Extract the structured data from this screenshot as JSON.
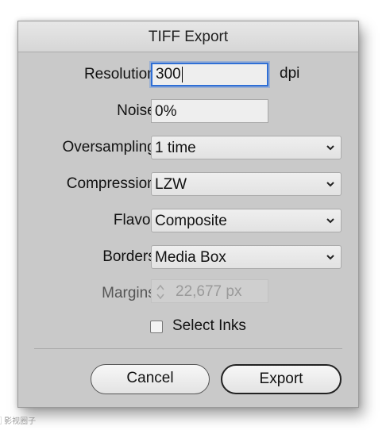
{
  "dialog": {
    "title": "TIFF Export"
  },
  "fields": {
    "resolution": {
      "label": "Resolution:",
      "value": "300",
      "unit": "dpi"
    },
    "noise": {
      "label": "Noise:",
      "value": "0%"
    },
    "oversampling": {
      "label": "Oversampling:",
      "value": "1 time"
    },
    "compression": {
      "label": "Compression:",
      "value": "LZW"
    },
    "flavor": {
      "label": "Flavor:",
      "value": "Composite"
    },
    "borders": {
      "label": "Borders:",
      "value": "Media Box"
    },
    "margins": {
      "label": "Margins:",
      "value": "22,677 px",
      "disabled": true
    }
  },
  "select_inks": {
    "label": "Select Inks",
    "checked": false
  },
  "buttons": {
    "cancel": "Cancel",
    "export": "Export"
  },
  "watermark": "⃞ 影视圈子",
  "colors": {
    "dialog_bg": "#c9c9c9",
    "focus_ring": "#2f6fd6",
    "disabled_text": "#9a9a9a"
  },
  "icons": {
    "select_chevron": "chevron-down-icon",
    "stepper_arrows": "stepper-arrows-icon"
  }
}
